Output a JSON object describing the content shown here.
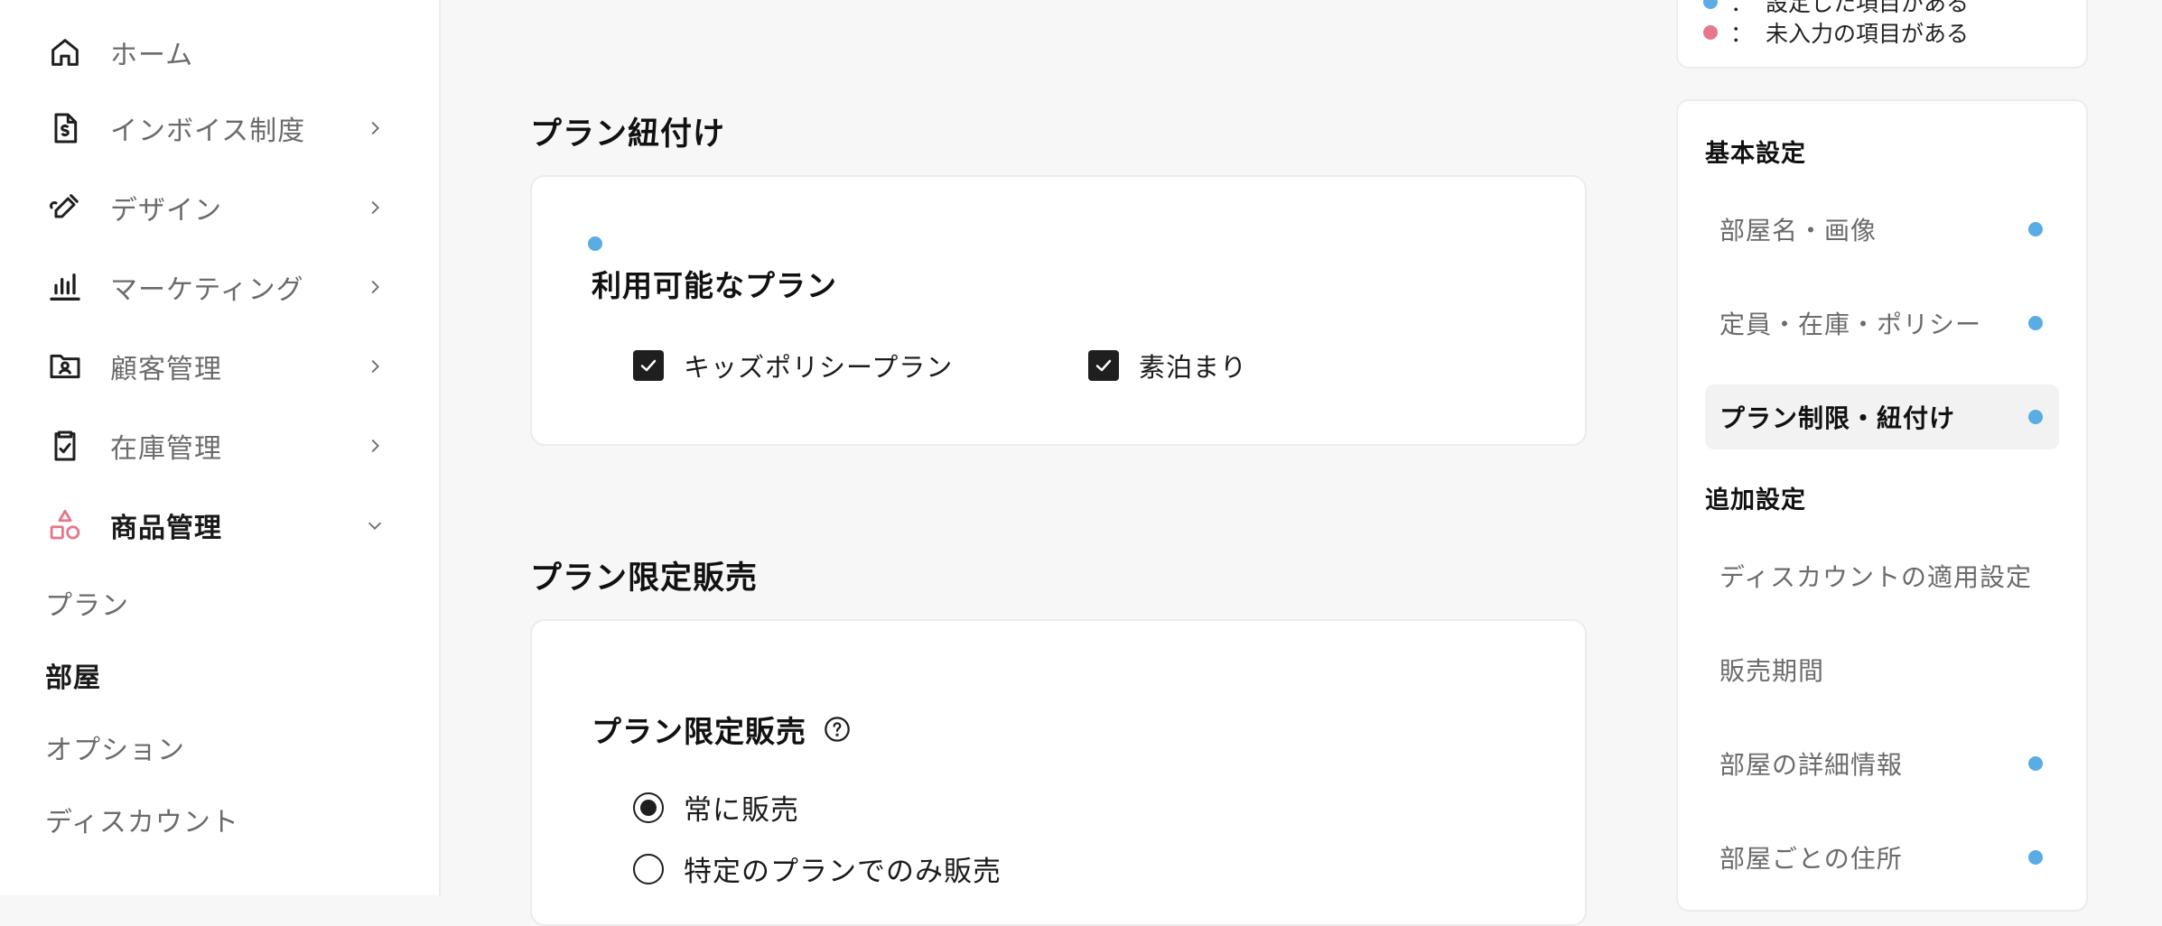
{
  "sidebar": {
    "nav": [
      {
        "label": "ホーム",
        "icon": "home-icon",
        "expandable": false
      },
      {
        "label": "インボイス制度",
        "icon": "invoice-document-icon",
        "expandable": true
      },
      {
        "label": "デザイン",
        "icon": "design-pen-icon",
        "expandable": true
      },
      {
        "label": "マーケティング",
        "icon": "bar-chart-icon",
        "expandable": true
      },
      {
        "label": "顧客管理",
        "icon": "customer-folder-icon",
        "expandable": true
      },
      {
        "label": "在庫管理",
        "icon": "clipboard-check-icon",
        "expandable": true
      },
      {
        "label": "商品管理",
        "icon": "shapes-icon",
        "expandable": true,
        "expanded": true,
        "active": true
      }
    ],
    "sub_items": [
      {
        "label": "プラン",
        "active": false
      },
      {
        "label": "部屋",
        "active": true
      },
      {
        "label": "オプション",
        "active": false
      },
      {
        "label": "ディスカウント",
        "active": false
      }
    ]
  },
  "main": {
    "plan_link": {
      "section_title": "プラン紐付け",
      "heading": "利用可能なプラン",
      "status": "blue",
      "plans": [
        {
          "label": "キッズポリシープラン",
          "checked": true
        },
        {
          "label": "素泊まり",
          "checked": true
        }
      ]
    },
    "plan_limited": {
      "section_title": "プラン限定販売",
      "heading": "プラン限定販売",
      "help_icon": "question-circle-icon",
      "options": [
        {
          "label": "常に販売",
          "selected": true
        },
        {
          "label": "特定のプランでのみ販売",
          "selected": false
        }
      ]
    }
  },
  "legend": {
    "rows": [
      {
        "sep": "：",
        "label": "設定した項目がある",
        "color": "#5aace4"
      },
      {
        "sep": "：",
        "label": "未入力の項目がある",
        "color": "#e5788a"
      }
    ]
  },
  "toc": {
    "groups": [
      {
        "title": "基本設定"
      },
      {
        "title": "追加設定"
      }
    ],
    "basic_items": [
      {
        "label": "部屋名・画像",
        "dot": "blue",
        "active": false
      },
      {
        "label": "定員・在庫・ポリシー",
        "dot": "blue",
        "active": false
      },
      {
        "label": "プラン制限・紐付け",
        "dot": "blue",
        "active": true
      }
    ],
    "extra_items": [
      {
        "label": "ディスカウントの適用設定",
        "dot": null,
        "active": false
      },
      {
        "label": "販売期間",
        "dot": null,
        "active": false
      },
      {
        "label": "部屋の詳細情報",
        "dot": "blue",
        "active": false
      },
      {
        "label": "部屋ごとの住所",
        "dot": "blue",
        "active": false
      }
    ]
  },
  "colors": {
    "status_blue": "#5aace4",
    "status_red": "#e5788a",
    "active_icon": "#e5788a"
  }
}
